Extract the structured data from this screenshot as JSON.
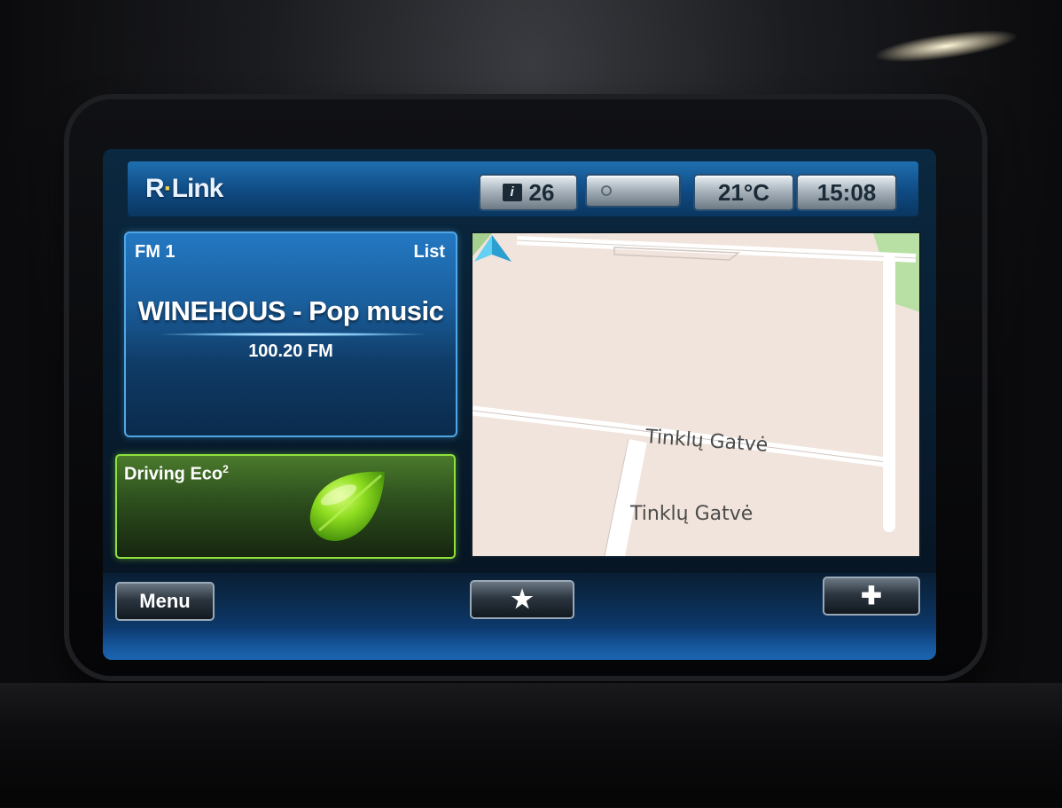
{
  "header": {
    "brand": "R-Link",
    "brand_prefix": "R",
    "brand_suffix": "Link",
    "notifications": "26",
    "temperature": "21°C",
    "time": "15:08"
  },
  "radio": {
    "band": "FM 1",
    "list_label": "List",
    "station": "WINEHOUS - Pop music",
    "frequency": "100.20 FM"
  },
  "eco": {
    "title": "Driving Eco",
    "superscript": "2"
  },
  "map": {
    "street_label_1": "Tinklų Gatvė",
    "street_label_2": "Tinklų Gatvė"
  },
  "bottom": {
    "menu_label": "Menu",
    "favorites_icon": "star-icon",
    "add_icon": "plus-icon"
  },
  "colors": {
    "accent_blue": "#1f6fb0",
    "eco_green": "#8ee23b",
    "nav_arrow": "#3fb6e0"
  }
}
